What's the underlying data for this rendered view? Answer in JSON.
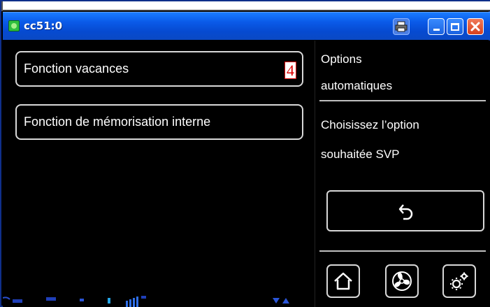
{
  "window": {
    "title": "cc51:0"
  },
  "menu": {
    "items": [
      {
        "label": "Fonction vacances",
        "badge": "4"
      },
      {
        "label": "Fonction de mémorisation interne"
      }
    ]
  },
  "side": {
    "title_line1": "Options",
    "title_line2": "automatiques",
    "hint_line1": "Choisissez l’option",
    "hint_line2": "souhaitée SVP"
  },
  "icons": {
    "app": "app-icon",
    "printer": "printer-icon",
    "minimize": "minimize-icon",
    "maximize": "maximize-icon",
    "close": "close-icon",
    "back": "back-arrow-icon",
    "home": "home-icon",
    "fan": "fan-icon",
    "settings": "gear-icon"
  },
  "colors": {
    "titlebar": "#0a5ae8",
    "background": "#000000",
    "foreground": "#ffffff",
    "badge_text": "#e00000",
    "close_button": "#d8401c"
  }
}
